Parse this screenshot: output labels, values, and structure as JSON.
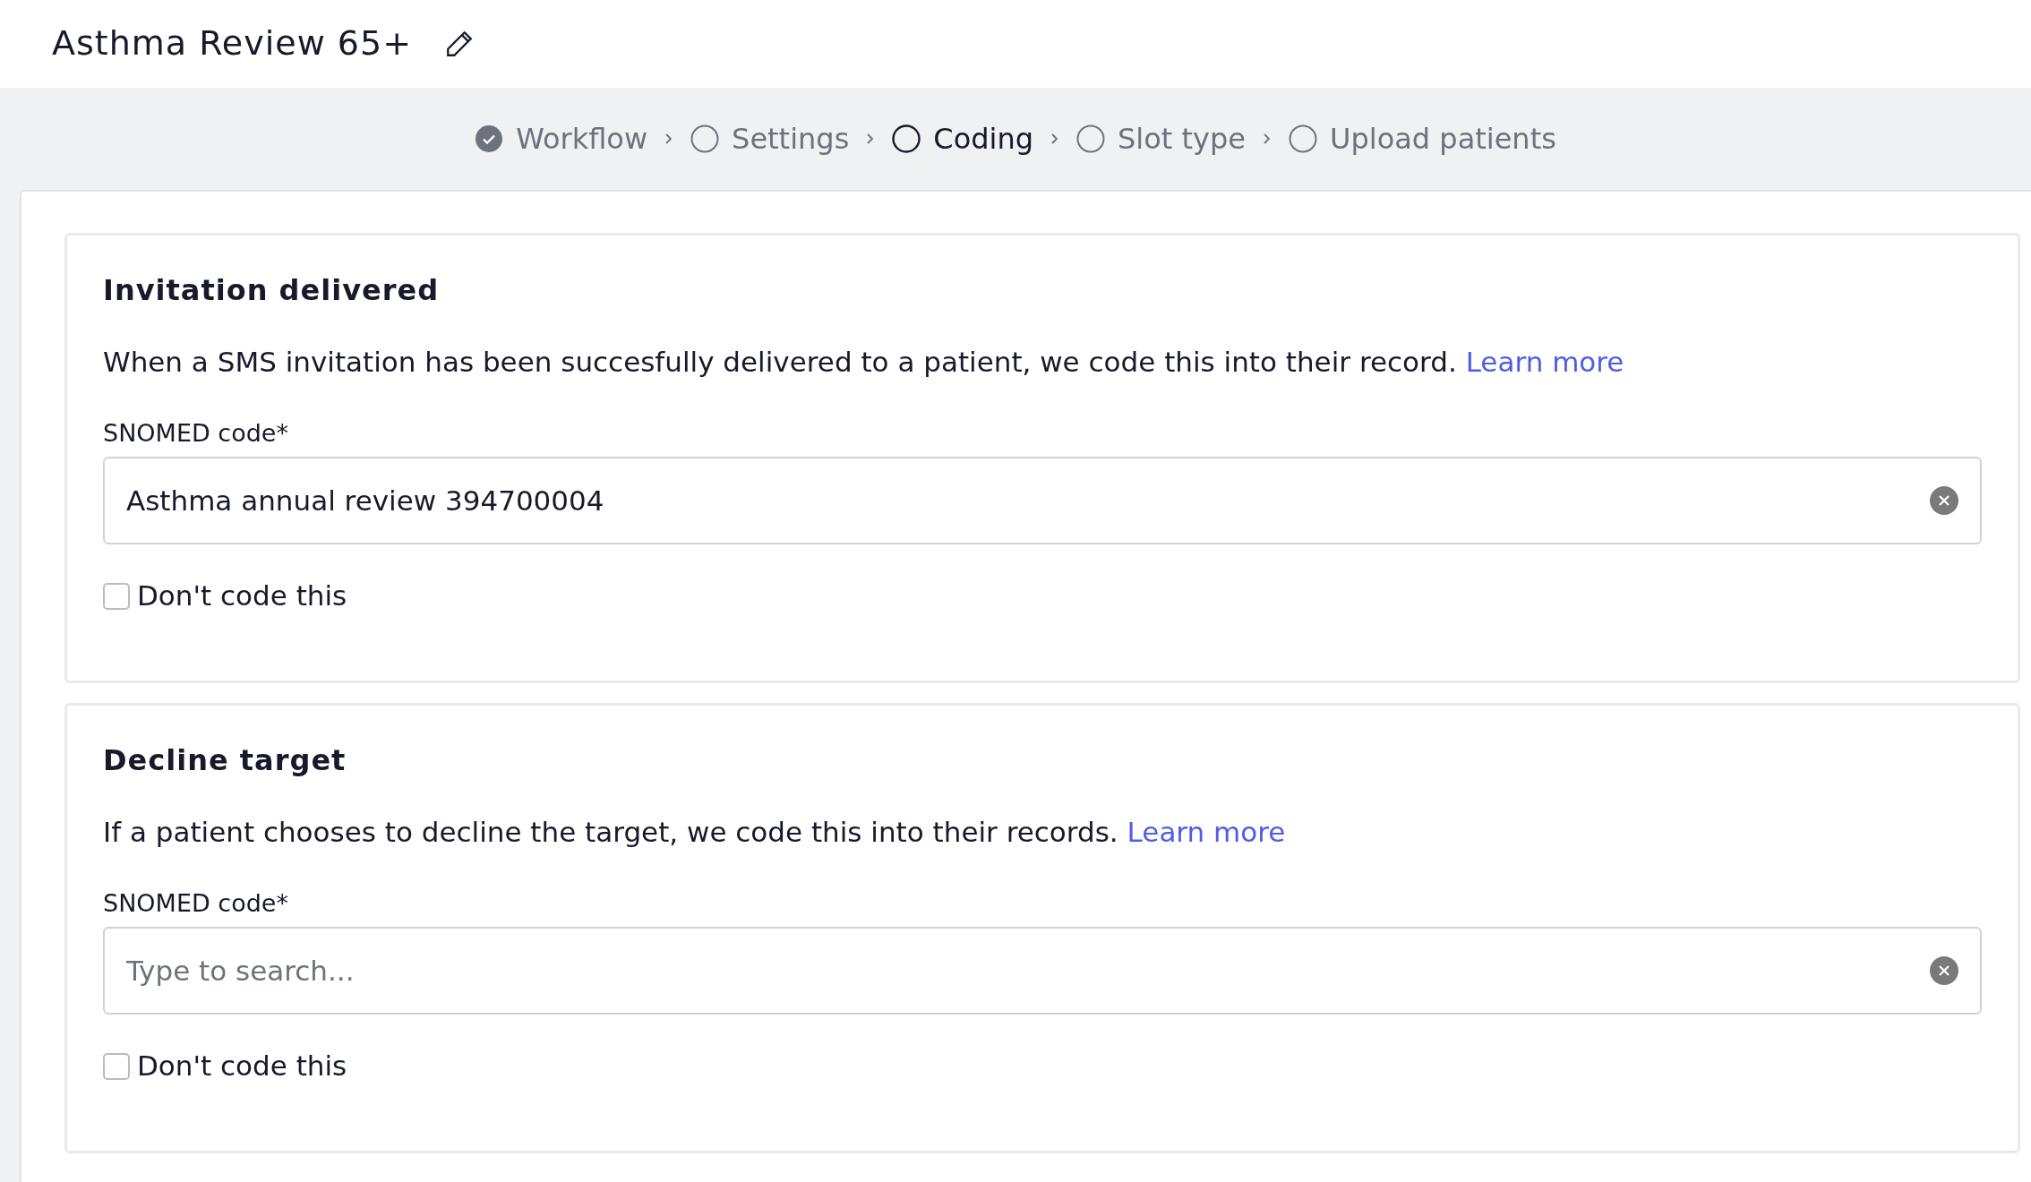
{
  "title": "Asthma Review 65+",
  "steps": [
    {
      "label": "Workflow",
      "completed": true,
      "selected": false
    },
    {
      "label": "Settings",
      "completed": false,
      "selected": false
    },
    {
      "label": "Coding",
      "completed": false,
      "selected": true
    },
    {
      "label": "Slot type",
      "completed": false,
      "selected": false
    },
    {
      "label": "Upload patients",
      "completed": false,
      "selected": false
    }
  ],
  "sections": [
    {
      "heading": "Invitation delivered",
      "description": "When a SMS invitation has been succesfully delivered to a patient, we code this into their record.",
      "link": "Learn more",
      "field_label": "SNOMED code*",
      "value": "Asthma annual review 394700004",
      "dont_code": {
        "label": "Don't code this",
        "checked": false
      }
    },
    {
      "heading": "Decline target",
      "description": "If a patient chooses to decline the target, we code this into their records.",
      "link": "Learn more",
      "field_label": "SNOMED code*",
      "placeholder": "Type to search...",
      "dont_code": {
        "label": "Don't code this",
        "checked": false
      }
    }
  ]
}
